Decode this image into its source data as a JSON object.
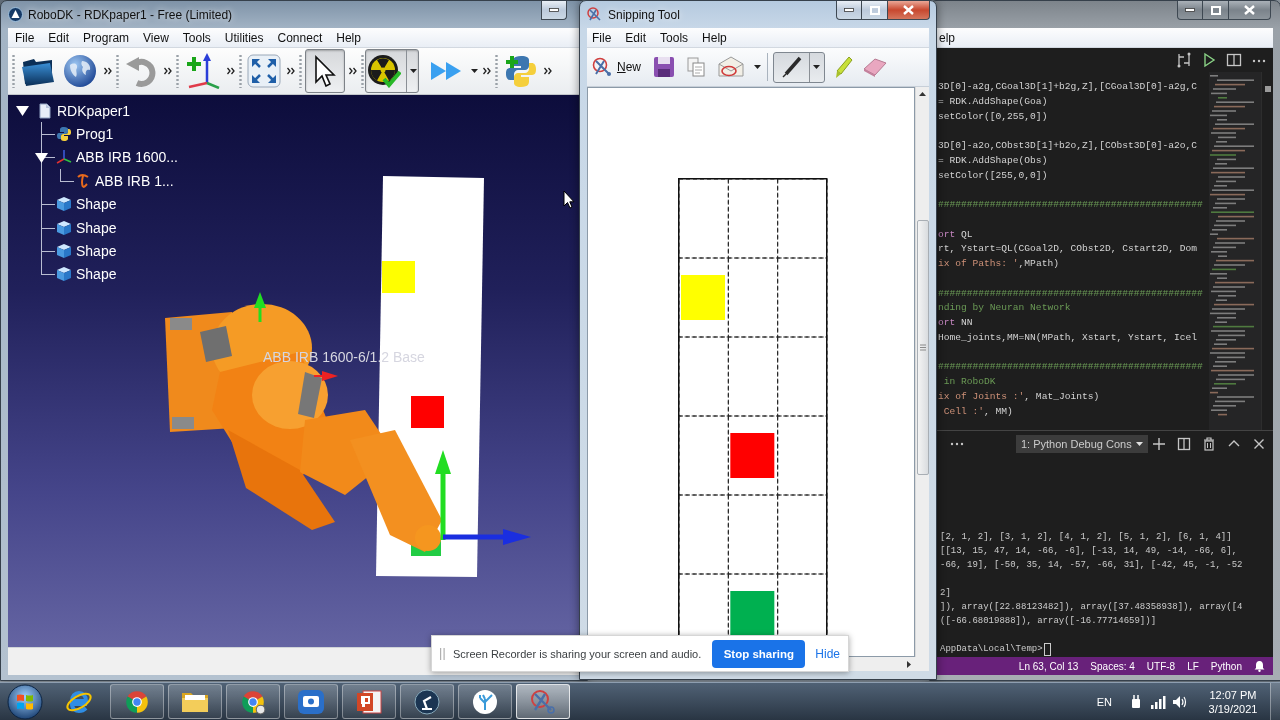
{
  "robodk": {
    "title": "RoboDK - RDKpaper1 - Free (Limited)",
    "menu": [
      "File",
      "Edit",
      "Program",
      "View",
      "Tools",
      "Utilities",
      "Connect",
      "Help"
    ],
    "toolbar": {
      "pointer_pressed": true,
      "radiation_pressed": true
    },
    "tree": [
      {
        "label": "RDKpaper1",
        "kind": "station",
        "expanded": true,
        "children": [
          {
            "label": "Prog1",
            "kind": "program"
          },
          {
            "label": "ABB IRB 1600...",
            "kind": "frame",
            "expanded": true,
            "children": [
              {
                "label": "ABB IRB 1...",
                "kind": "robot"
              }
            ]
          },
          {
            "label": "Shape",
            "kind": "shape"
          },
          {
            "label": "Shape",
            "kind": "shape"
          },
          {
            "label": "Shape",
            "kind": "shape"
          },
          {
            "label": "Shape",
            "kind": "shape"
          }
        ]
      }
    ],
    "scene": {
      "label": "ABB IRB 1600-6/1.2 Base",
      "markers": [
        {
          "color": "#ffff00"
        },
        {
          "color": "#ff0000"
        },
        {
          "color": "#22cc44"
        }
      ]
    }
  },
  "snipping_tool": {
    "title": "Snipping Tool",
    "menu": [
      "File",
      "Edit",
      "Tools",
      "Help"
    ],
    "toolbar": {
      "new_label": "New",
      "pen_pressed": true
    },
    "snip": {
      "rows": [
        {
          "cells": [
            {
              "filled": false
            },
            {
              "filled": false
            },
            {
              "filled": false
            }
          ]
        },
        {
          "cells": [
            {
              "filled": true,
              "color": "#ffff00"
            },
            {
              "filled": false
            },
            {
              "filled": false
            }
          ]
        },
        {
          "cells": [
            {
              "filled": false
            },
            {
              "filled": false
            },
            {
              "filled": false
            }
          ]
        },
        {
          "cells": [
            {
              "filled": false
            },
            {
              "filled": true,
              "color": "#ff0000"
            },
            {
              "filled": false
            }
          ]
        },
        {
          "cells": [
            {
              "filled": false
            },
            {
              "filled": false
            },
            {
              "filled": false
            }
          ]
        },
        {
          "cells": [
            {
              "filled": false
            },
            {
              "filled": true,
              "color": "#00b050"
            },
            {
              "filled": false
            }
          ]
        }
      ]
    }
  },
  "editor": {
    "menu_fragment": "elp",
    "code_blocks": [
      [
        {
          "tokens": [
            {
              "text": "3D[0]-a2g,CGoal3D[1]+b2g,Z],[CGoal3D[0]-a2g,C",
              "kind": "plain"
            }
          ]
        },
        {
          "tokens": [
            {
              "text": "= RDK.AddShape(Goa)",
              "kind": "plain"
            }
          ]
        },
        {
          "tokens": [
            {
              "text": "setColor([0,255,0])",
              "kind": "plain"
            }
          ]
        }
      ],
      [
        {
          "tokens": [
            {
              "text": "3D[0]-a2o,CObst3D[1]+b2o,Z],[CObst3D[0]-a2o,C",
              "kind": "plain"
            }
          ]
        },
        {
          "tokens": [
            {
              "text": "= RDK.AddShape(Obs)",
              "kind": "plain"
            }
          ]
        },
        {
          "tokens": [
            {
              "text": "setColor([255,0,0])",
              "kind": "plain"
            }
          ]
        }
      ],
      [
        {
          "tokens": [
            {
              "text": "##############################################",
              "kind": "comment"
            }
          ]
        }
      ],
      [
        {
          "tokens": [
            {
              "text": "ort",
              "kind": "keyword"
            },
            {
              "text": " QL",
              "kind": "plain"
            }
          ]
        },
        {
          "tokens": [
            {
              "text": "rt, Ystart=QL(CGoal2D, CObst2D, Cstart2D, Dom",
              "kind": "plain"
            }
          ]
        },
        {
          "tokens": [
            {
              "text": "ix of Paths: '",
              "kind": "string"
            },
            {
              "text": ",MPath)",
              "kind": "plain"
            }
          ]
        }
      ],
      [
        {
          "tokens": [
            {
              "text": "##############################################",
              "kind": "comment"
            }
          ]
        },
        {
          "tokens": [
            {
              "text": "nding by Neuran Network",
              "kind": "comment"
            }
          ]
        },
        {
          "tokens": [
            {
              "text": "ort",
              "kind": "keyword"
            },
            {
              "text": " NN",
              "kind": "plain"
            }
          ]
        },
        {
          "tokens": [
            {
              "text": "Home_joints,MM=NN(MPath, Xstart, Ystart, Icel",
              "kind": "plain"
            }
          ]
        }
      ],
      [
        {
          "tokens": [
            {
              "text": "##############################################",
              "kind": "comment"
            }
          ]
        },
        {
          "tokens": [
            {
              "text": " in RoboDK",
              "kind": "comment"
            }
          ]
        },
        {
          "tokens": [
            {
              "text": "ix of Joints :'",
              "kind": "string"
            },
            {
              "text": ", Mat_Joints)",
              "kind": "plain"
            }
          ]
        },
        {
          "tokens": [
            {
              "text": " Cell :'",
              "kind": "string"
            },
            {
              "text": ", MM)",
              "kind": "plain"
            }
          ]
        }
      ]
    ],
    "terminal": {
      "session": "1: Python Debug Cons",
      "blocks": [
        [
          "[2, 1, 2], [3, 1, 2], [4, 1, 2], [5, 1, 2], [6, 1, 4]]",
          "[[13, 15, 47, 14, -66, -6], [-13, 14, 49, -14, -66, 6],",
          "-66, 19], [-50, 35, 14, -57, -66, 31], [-42, 45, -1, -52"
        ],
        [
          "2]",
          "]), array([22.88123482]), array([37.48358938]), array([4",
          "([-66.68019888]), array([-16.77714659])]"
        ],
        [
          "AppData\\Local\\Temp>"
        ]
      ]
    },
    "status_bar": [
      "Ln 63, Col 13",
      "Spaces: 4",
      "UTF-8",
      "LF",
      "Python"
    ]
  },
  "notification": {
    "message": "Screen Recorder is sharing your screen and audio.",
    "button": "Stop sharing",
    "link": "Hide"
  },
  "taskbar": {
    "apps": [
      {
        "kind": "browser",
        "running": false,
        "selected": false
      },
      {
        "kind": "wheel",
        "running": true,
        "selected": false
      },
      {
        "kind": "folder",
        "running": true,
        "selected": false
      },
      {
        "kind": "wheel_badge",
        "running": true,
        "selected": false
      },
      {
        "kind": "recorder",
        "running": true,
        "selected": false
      },
      {
        "kind": "slides",
        "running": true,
        "selected": false
      },
      {
        "kind": "robot",
        "running": true,
        "selected": false
      },
      {
        "kind": "coral",
        "running": true,
        "selected": false
      },
      {
        "kind": "scissors",
        "running": true,
        "selected": true
      }
    ],
    "language": "EN",
    "time": "12:07 PM",
    "date": "3/19/2021"
  }
}
